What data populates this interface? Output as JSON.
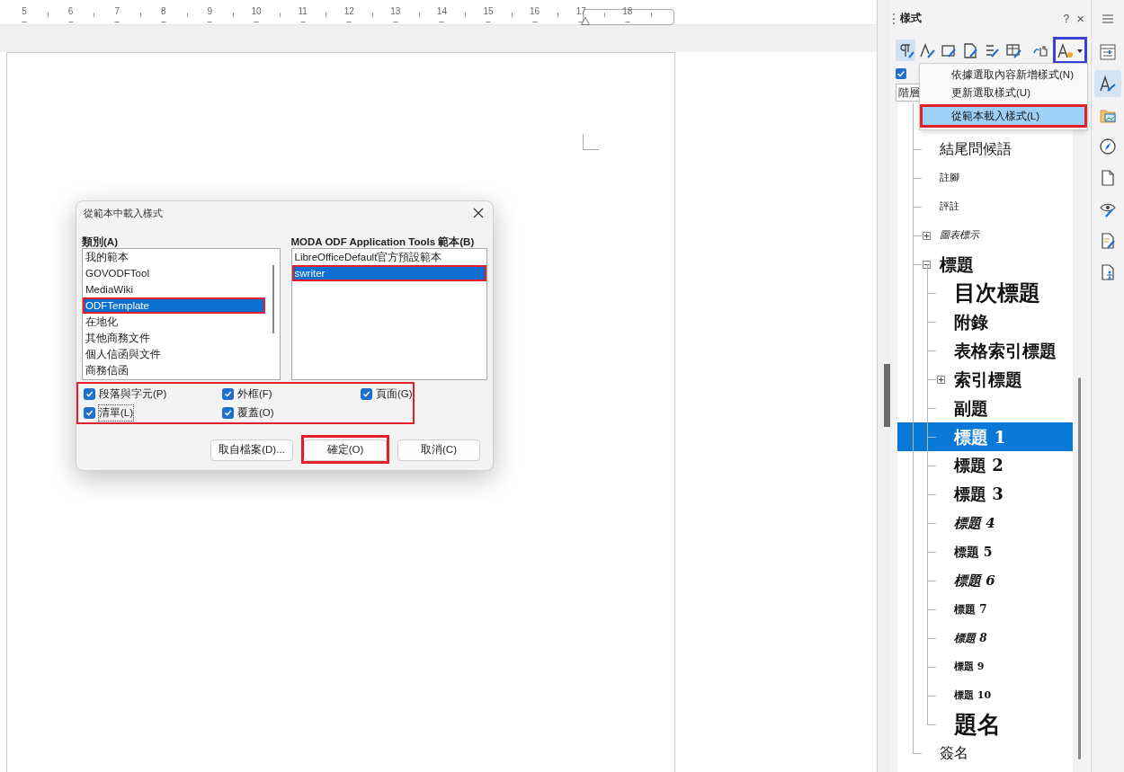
{
  "ruler": {
    "labels": [
      "5",
      "6",
      "7",
      "8",
      "9",
      "10",
      "11",
      "12",
      "13",
      "14",
      "15",
      "16",
      "17",
      "18"
    ]
  },
  "dialog": {
    "title": "從範本中載入樣式",
    "categories": {
      "label": "類別(A)",
      "items": [
        {
          "label": "我的範本",
          "selected": false,
          "highlighted": false
        },
        {
          "label": "GOVODFTool",
          "selected": false,
          "highlighted": false
        },
        {
          "label": "MediaWiki",
          "selected": false,
          "highlighted": false
        },
        {
          "label": "ODFTemplate",
          "selected": true,
          "highlighted": true
        },
        {
          "label": "在地化",
          "selected": false,
          "highlighted": false
        },
        {
          "label": "其他商務文件",
          "selected": false,
          "highlighted": false
        },
        {
          "label": "個人信函與文件",
          "selected": false,
          "highlighted": false
        },
        {
          "label": "商務信函",
          "selected": false,
          "highlighted": false
        }
      ]
    },
    "templates": {
      "label": "MODA ODF Application Tools 範本(B)",
      "items": [
        {
          "label": "LibreOfficeDefault官方預設範本",
          "selected": false,
          "highlighted": false
        },
        {
          "label": "swriter",
          "selected": true,
          "highlighted": true
        }
      ]
    },
    "options_highlighted": true,
    "options": [
      {
        "label": "段落與字元(P)",
        "checked": true,
        "focused": false
      },
      {
        "label": "外框(F)",
        "checked": true,
        "focused": false
      },
      {
        "label": "頁面(G)",
        "checked": true,
        "focused": false
      },
      {
        "label": "清單(L)",
        "checked": true,
        "focused": true
      },
      {
        "label": "覆蓋(O)",
        "checked": true,
        "focused": false
      }
    ],
    "buttons": [
      {
        "label": "取自檔案(D)...",
        "highlighted": false
      },
      {
        "label": "確定(O)",
        "highlighted": true
      },
      {
        "label": "取消(C)",
        "highlighted": false
      }
    ]
  },
  "sidebar": {
    "title": "樣式",
    "help": "?",
    "close": "×",
    "toolbar": [
      {
        "selected": true,
        "highlighted": false
      },
      {
        "selected": false,
        "highlighted": false
      },
      {
        "selected": false,
        "highlighted": false
      },
      {
        "selected": false,
        "highlighted": false
      },
      {
        "selected": false,
        "highlighted": false
      },
      {
        "selected": false,
        "highlighted": false
      },
      {
        "selected": false,
        "highlighted": false
      },
      {
        "selected": false,
        "highlighted": true
      }
    ],
    "show_previews_checked": true,
    "filter_value": "階層",
    "menu": [
      {
        "label": "依據選取內容新增樣式(N)",
        "selected": false,
        "highlighted": false
      },
      {
        "label": "更新選取樣式(U)",
        "selected": false,
        "highlighted": false
      },
      {
        "label": "從範本載入樣式(L)",
        "selected": true,
        "highlighted": true
      }
    ],
    "tree": [
      {
        "label": "結尾問候語",
        "kind": "body",
        "selected": false
      },
      {
        "label": "註腳",
        "kind": "tiny",
        "selected": false
      },
      {
        "label": "評註",
        "kind": "tiny",
        "selected": false
      },
      {
        "label": "圖表標示",
        "kind": "tiny-italic",
        "selected": false,
        "expanded": false
      },
      {
        "label": "標題",
        "kind": "heading",
        "selected": false,
        "expanded": true,
        "children": [
          {
            "label": "目次標題",
            "kind": "xl",
            "selected": false
          },
          {
            "label": "附錄",
            "kind": "l",
            "selected": false
          },
          {
            "label": "表格索引標題",
            "kind": "l",
            "selected": false
          },
          {
            "label": "索引標題",
            "kind": "l",
            "selected": false,
            "expanded": false
          },
          {
            "label": "副題",
            "kind": "l",
            "selected": false
          },
          {
            "label": "標題 1",
            "kind": "l",
            "selected": true
          },
          {
            "label": "標題 2",
            "kind": "m",
            "selected": false
          },
          {
            "label": "標題 3",
            "kind": "m",
            "selected": false
          },
          {
            "label": "標題 4",
            "kind": "m-italic",
            "selected": false
          },
          {
            "label": "標題 5",
            "kind": "s",
            "selected": false
          },
          {
            "label": "標題 6",
            "kind": "s-italic",
            "selected": false
          },
          {
            "label": "標題 7",
            "kind": "xs",
            "selected": false
          },
          {
            "label": "標題 8",
            "kind": "xs-italic",
            "selected": false
          },
          {
            "label": "標題 9",
            "kind": "xxs",
            "selected": false
          },
          {
            "label": "標題 10",
            "kind": "xxs",
            "selected": false
          },
          {
            "label": "題名",
            "kind": "title",
            "selected": false
          }
        ]
      },
      {
        "label": "簽名",
        "kind": "body",
        "selected": false
      }
    ],
    "deck": [
      {
        "selected": false
      },
      {
        "selected": true
      },
      {
        "selected": false
      },
      {
        "selected": false
      },
      {
        "selected": false
      },
      {
        "selected": false
      },
      {
        "selected": false
      },
      {
        "selected": false
      }
    ]
  }
}
